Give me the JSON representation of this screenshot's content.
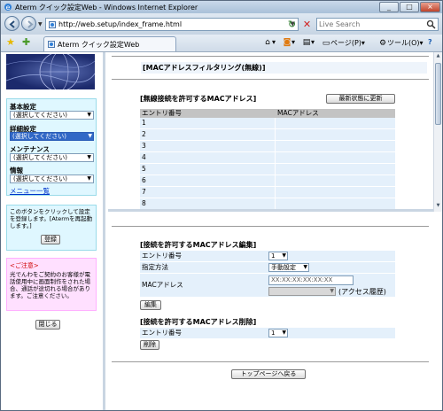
{
  "window": {
    "title": "Aterm クイック設定Web - Windows Internet Explorer"
  },
  "address": {
    "url": "http://web.setup/index_frame.html"
  },
  "search": {
    "placeholder": "Live Search"
  },
  "tab": {
    "label": "Aterm クイック設定Web"
  },
  "commands": {
    "page": "ページ(P)",
    "tools": "ツール(O)"
  },
  "sidebar": {
    "basic_heading": "基本設定",
    "basic_select": "(選択してください)",
    "detail_heading": "詳細設定",
    "detail_select": "(選択してください)",
    "maintenance_heading": "メンテナンス",
    "maintenance_select": "(選択してください)",
    "info_heading": "情報",
    "info_select": "(選択してください)",
    "menu_list": "メニュー一覧",
    "info_text": "このボタンをクリックして設定を登録します。[Atermを再起動します。]",
    "register_button": "登録",
    "caution_heading": "<ご注意>",
    "caution_text": "光でんわをご契約のお客様が電話使用中に画面制作をされた場合、通話が途切れる場合があります。ご注意ください。",
    "close_button": "閉じる"
  },
  "top_frame": {
    "page_title": "[MACアドレスフィルタリング(無線)]",
    "section_title": "[無線接続を許可するMACアドレス]",
    "refresh_button": "最新状態に更新",
    "col_entry": "エントリ番号",
    "col_mac": "MACアドレス",
    "rows": [
      "1",
      "2",
      "3",
      "4",
      "5",
      "6",
      "7",
      "8"
    ]
  },
  "bottom_frame": {
    "edit_title": "[接続を許可するMACアドレス編集]",
    "entry_label": "エントリ番号",
    "entry_value": "1",
    "method_label": "指定方法",
    "method_value": "手動設定",
    "mac_label": "MACアドレス",
    "mac_placeholder": "XX:XX:XX:XX:XX:XX",
    "access_history": "(アクセス履歴)",
    "edit_button": "編集",
    "delete_title": "[接続を許可するMACアドレス削除]",
    "delete_entry_label": "エントリ番号",
    "delete_entry_value": "1",
    "delete_button": "削除",
    "back_button": "トップページへ戻る"
  }
}
